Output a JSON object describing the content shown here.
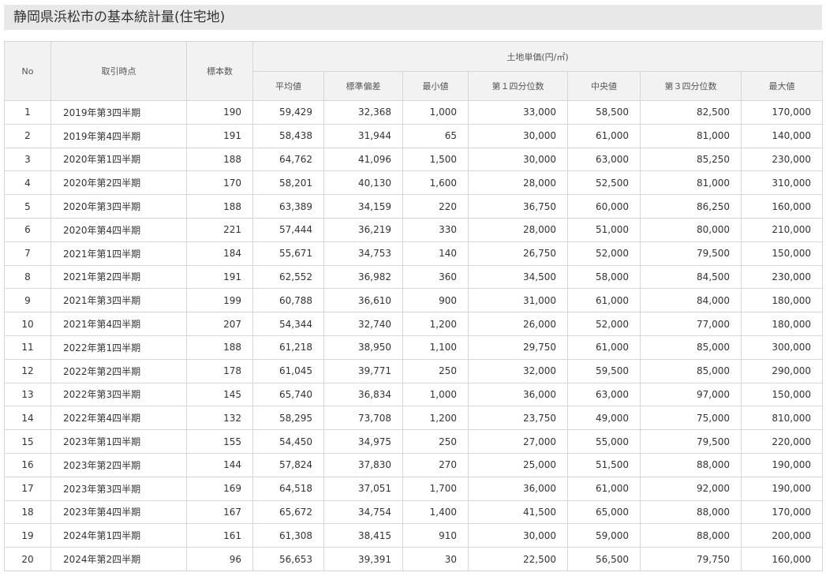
{
  "title": "静岡県浜松市の基本統計量(住宅地)",
  "table": {
    "headers": {
      "no": "No",
      "period": "取引時点",
      "samples": "標本数",
      "group": "土地単価(円/㎡)",
      "sub": [
        "平均値",
        "標準偏差",
        "最小値",
        "第１四分位数",
        "中央値",
        "第３四分位数",
        "最大値"
      ]
    },
    "rows": [
      [
        "1",
        "2019年第3四半期",
        "190",
        "59,429",
        "32,368",
        "1,000",
        "33,000",
        "58,500",
        "82,500",
        "170,000"
      ],
      [
        "2",
        "2019年第4四半期",
        "191",
        "58,438",
        "31,944",
        "65",
        "30,000",
        "61,000",
        "81,000",
        "140,000"
      ],
      [
        "3",
        "2020年第1四半期",
        "188",
        "64,762",
        "41,096",
        "1,500",
        "30,000",
        "63,000",
        "85,250",
        "230,000"
      ],
      [
        "4",
        "2020年第2四半期",
        "170",
        "58,201",
        "40,130",
        "1,600",
        "28,000",
        "52,500",
        "81,000",
        "310,000"
      ],
      [
        "5",
        "2020年第3四半期",
        "188",
        "63,389",
        "34,159",
        "220",
        "36,750",
        "60,000",
        "86,250",
        "160,000"
      ],
      [
        "6",
        "2020年第4四半期",
        "221",
        "57,444",
        "36,219",
        "330",
        "28,000",
        "51,000",
        "80,000",
        "210,000"
      ],
      [
        "7",
        "2021年第1四半期",
        "184",
        "55,671",
        "34,753",
        "140",
        "26,750",
        "52,000",
        "79,500",
        "150,000"
      ],
      [
        "8",
        "2021年第2四半期",
        "191",
        "62,552",
        "36,982",
        "360",
        "34,500",
        "58,000",
        "84,500",
        "230,000"
      ],
      [
        "9",
        "2021年第3四半期",
        "199",
        "60,788",
        "36,610",
        "900",
        "31,000",
        "61,000",
        "84,000",
        "180,000"
      ],
      [
        "10",
        "2021年第4四半期",
        "207",
        "54,344",
        "32,740",
        "1,200",
        "26,000",
        "52,000",
        "77,000",
        "180,000"
      ],
      [
        "11",
        "2022年第1四半期",
        "188",
        "61,218",
        "38,950",
        "1,100",
        "29,750",
        "61,000",
        "85,000",
        "300,000"
      ],
      [
        "12",
        "2022年第2四半期",
        "178",
        "61,045",
        "39,771",
        "250",
        "32,000",
        "59,500",
        "85,000",
        "290,000"
      ],
      [
        "13",
        "2022年第3四半期",
        "145",
        "65,740",
        "36,834",
        "1,000",
        "36,000",
        "63,000",
        "97,000",
        "150,000"
      ],
      [
        "14",
        "2022年第4四半期",
        "132",
        "58,295",
        "73,708",
        "1,200",
        "23,750",
        "49,000",
        "75,000",
        "810,000"
      ],
      [
        "15",
        "2023年第1四半期",
        "155",
        "54,450",
        "34,975",
        "250",
        "27,000",
        "55,000",
        "79,500",
        "220,000"
      ],
      [
        "16",
        "2023年第2四半期",
        "144",
        "57,824",
        "37,830",
        "270",
        "25,000",
        "51,500",
        "88,000",
        "190,000"
      ],
      [
        "17",
        "2023年第3四半期",
        "169",
        "64,518",
        "37,051",
        "1,700",
        "36,000",
        "61,000",
        "92,000",
        "190,000"
      ],
      [
        "18",
        "2023年第4四半期",
        "167",
        "65,672",
        "34,754",
        "1,400",
        "41,500",
        "65,000",
        "88,000",
        "170,000"
      ],
      [
        "19",
        "2024年第1四半期",
        "161",
        "61,308",
        "38,415",
        "910",
        "30,000",
        "59,000",
        "88,000",
        "200,000"
      ],
      [
        "20",
        "2024年第2四半期",
        "96",
        "56,653",
        "39,391",
        "30",
        "22,500",
        "56,500",
        "79,750",
        "160,000"
      ]
    ]
  }
}
